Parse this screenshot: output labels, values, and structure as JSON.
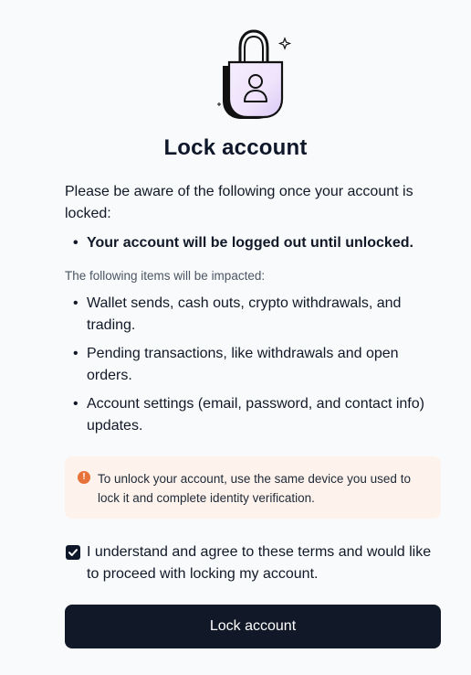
{
  "dialog": {
    "title": "Lock account",
    "intro": "Please be aware of the following once your account is locked:",
    "key_points": [
      "Your account will be logged out until unlocked."
    ],
    "impact_label": "The following items will be impacted:",
    "impacted_items": [
      "Wallet sends, cash outs, crypto withdrawals, and trading.",
      "Pending transactions, like withdrawals and open orders.",
      "Account settings (email, password, and contact info) updates."
    ],
    "bullet": "•"
  },
  "notice": {
    "icon": "alert-circle-icon",
    "icon_glyph": "!",
    "text": "To unlock your account, use the same device you used to lock it and complete identity verification.",
    "background_color": "#fdf3ec",
    "icon_color": "#e8733a"
  },
  "agreement": {
    "checked": true,
    "label": "I understand and agree to these terms and would like to proceed with locking my account."
  },
  "actions": {
    "lock_button_label": "Lock account",
    "button_color": "#111827"
  },
  "illustration": {
    "icon": "padlock-user-icon"
  }
}
